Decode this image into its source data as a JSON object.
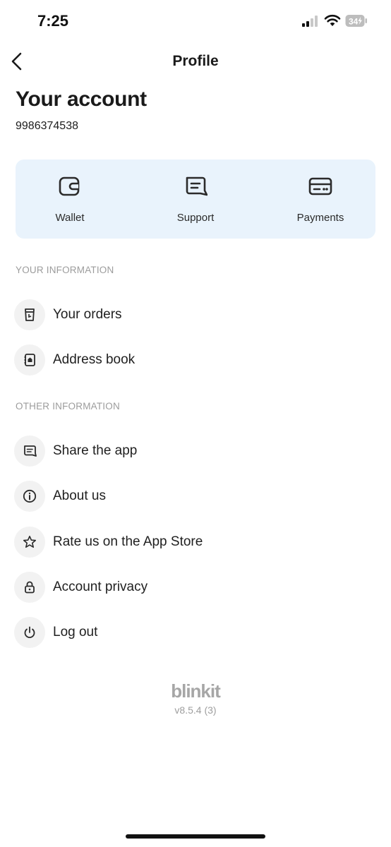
{
  "status_bar": {
    "time": "7:25",
    "battery_level": "34"
  },
  "header": {
    "title": "Profile"
  },
  "account": {
    "heading": "Your account",
    "phone": "9986374538"
  },
  "quick_actions": [
    {
      "label": "Wallet",
      "icon": "wallet-icon"
    },
    {
      "label": "Support",
      "icon": "chat-support-icon"
    },
    {
      "label": "Payments",
      "icon": "credit-card-icon"
    }
  ],
  "sections": {
    "your_information": {
      "title": "YOUR INFORMATION",
      "items": [
        {
          "label": "Your orders",
          "icon": "order-bag-icon"
        },
        {
          "label": "Address book",
          "icon": "address-book-icon"
        }
      ]
    },
    "other_information": {
      "title": "OTHER INFORMATION",
      "items": [
        {
          "label": "Share the app",
          "icon": "share-message-icon"
        },
        {
          "label": "About us",
          "icon": "info-icon"
        },
        {
          "label": "Rate us on the App Store",
          "icon": "star-icon"
        },
        {
          "label": "Account privacy",
          "icon": "lock-icon"
        },
        {
          "label": "Log out",
          "icon": "power-icon"
        }
      ]
    }
  },
  "footer": {
    "brand": "blinkit",
    "version": "v8.5.4 (3)"
  },
  "colors": {
    "quick_card_bg": "#e9f3fc",
    "icon_circle_bg": "#f2f2f2",
    "section_header": "#9c9c9c"
  }
}
